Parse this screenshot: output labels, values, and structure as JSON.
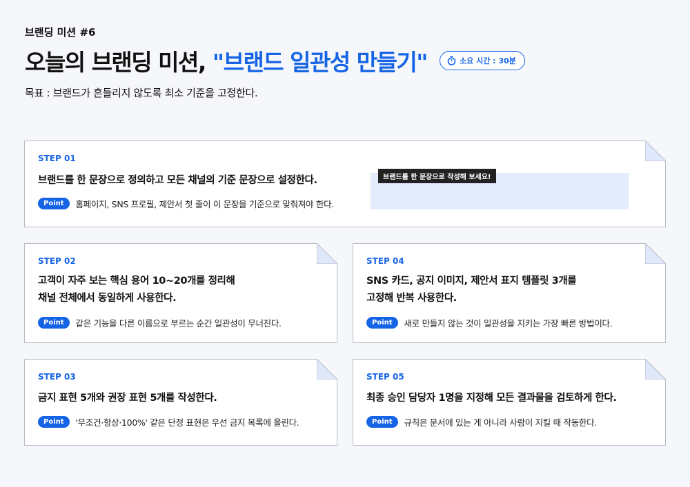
{
  "header": {
    "kicker": "브랜딩 미션 #6",
    "title_prefix": "오늘의 브랜딩 미션, ",
    "title_accent": "\"브랜드 일관성 만들기\"",
    "time_badge": "소요 시간 : 30분",
    "goal": "목표 : 브랜드가 흔들리지 않도록 최소 기준을 고정한다."
  },
  "point_label": "Point",
  "colors": {
    "accent": "#1664e6",
    "input_bg": "#e3ecfd",
    "border": "#b9bcc6"
  },
  "steps": {
    "s1": {
      "label": "STEP 01",
      "line1": "브랜드를 한 문장으로 정의하고 모든 채널의 기준 문장으로 설정한다.",
      "point": "홈페이지, SNS 프로필, 제안서 첫 줄이 이 문장을 기준으로 맞춰져야 한다.",
      "tooltip": "브랜드를 한 문장으로 작성해 보세요!"
    },
    "s2": {
      "label": "STEP 02",
      "line1": "고객이 자주 보는 핵심 용어 10~20개를 정리해",
      "line2": "채널 전체에서 동일하게 사용한다.",
      "point": "같은 기능을 다른 이름으로 부르는 순간 일관성이 무너진다."
    },
    "s3": {
      "label": "STEP 03",
      "line1": "금지 표현 5개와 권장 표현 5개를 작성한다.",
      "point": "'무조건·항상·100%' 같은 단정 표현은 우선 금지 목록에 올린다."
    },
    "s4": {
      "label": "STEP 04",
      "line1": "SNS 카드, 공지 이미지, 제안서 표지 템플릿 3개를",
      "line2": "고정해 반복 사용한다.",
      "point": "새로 만들지 않는 것이 일관성을 지키는 가장 빠른 방법이다."
    },
    "s5": {
      "label": "STEP 05",
      "line1": "최종 승인 담당자 1명을 지정해 모든 결과물을 검토하게 한다.",
      "point": "규칙은 문서에 있는 게 아니라 사람이 지킬 때 작동한다."
    }
  }
}
